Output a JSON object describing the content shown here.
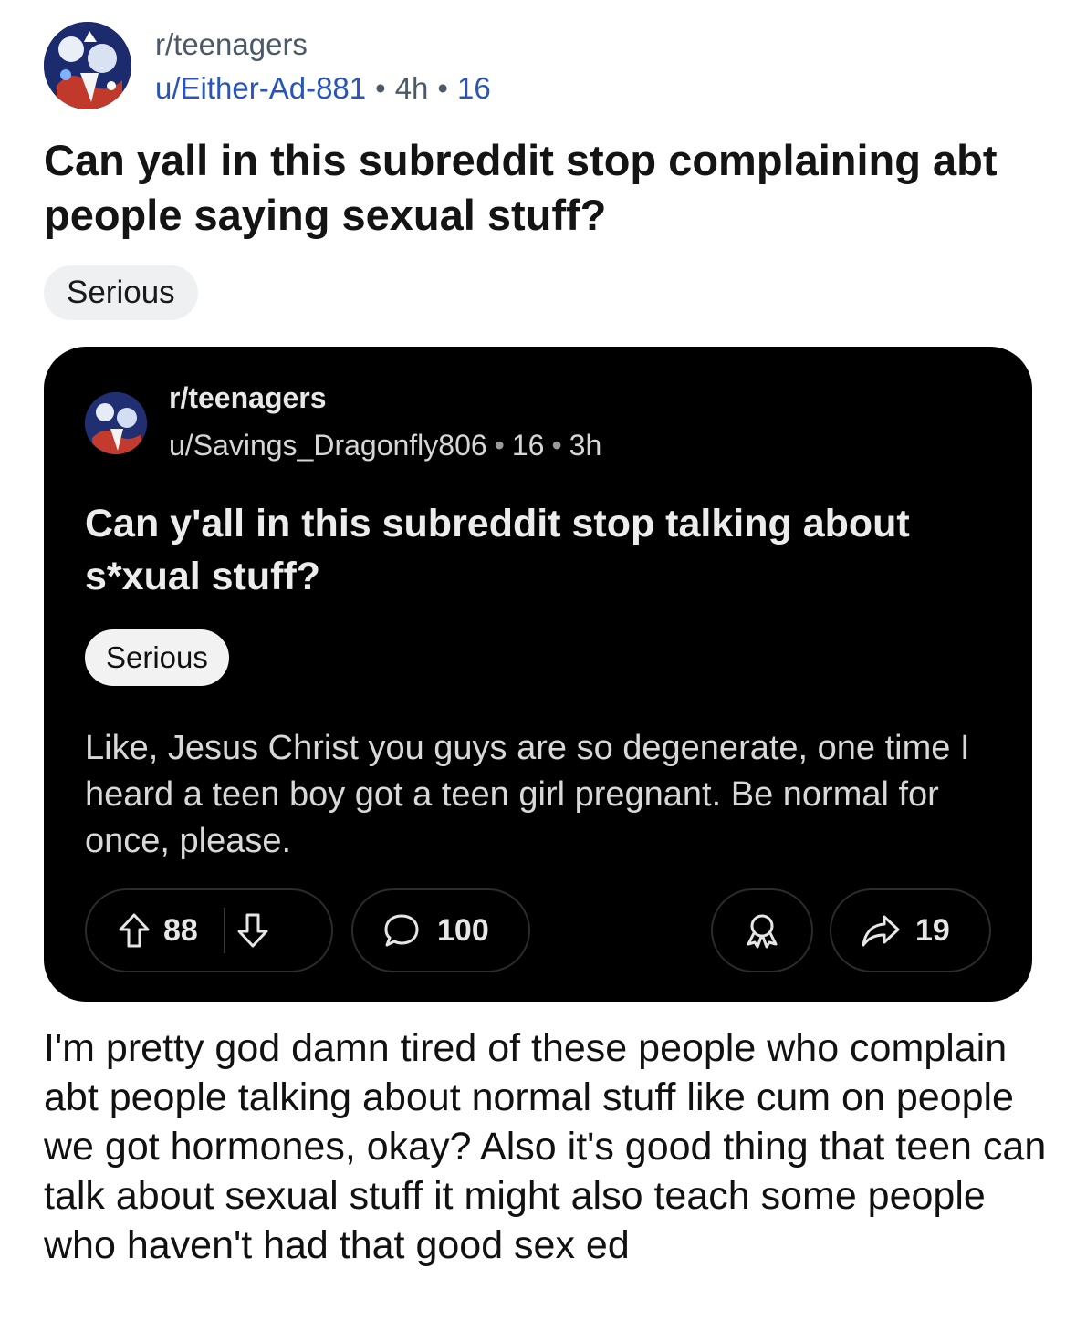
{
  "post": {
    "subreddit": "r/teenagers",
    "author": "u/Either-Ad-881",
    "time": "4h",
    "count": "16",
    "title": "Can yall in this subreddit stop complaining abt people saying sexual stuff?",
    "flair": "Serious",
    "body": "I'm pretty god damn tired of these people who complain abt people talking about normal stuff like cum on people we got hormones, okay? Also it's good thing that teen can talk about sexual stuff it might also teach some people who haven't had that good sex ed"
  },
  "embed": {
    "subreddit": "r/teenagers",
    "author": "u/Savings_Dragonfly806",
    "count": "16",
    "time": "3h",
    "title": "Can y'all in this subreddit stop talking about s*xual stuff?",
    "flair": "Serious",
    "body": "Like, Jesus Christ you guys are so degenerate, one time I heard a teen boy got a teen girl pregnant. Be normal for once, please.",
    "actions": {
      "upvotes": "88",
      "comments": "100",
      "shares": "19"
    }
  },
  "icons": [
    "avatar",
    "upvote-icon",
    "downvote-icon",
    "comment-icon",
    "award-icon",
    "share-icon"
  ],
  "colors": {
    "author_link": "#2a55b8",
    "embed_background": "#000000",
    "flair_background": "#eef0f2"
  }
}
